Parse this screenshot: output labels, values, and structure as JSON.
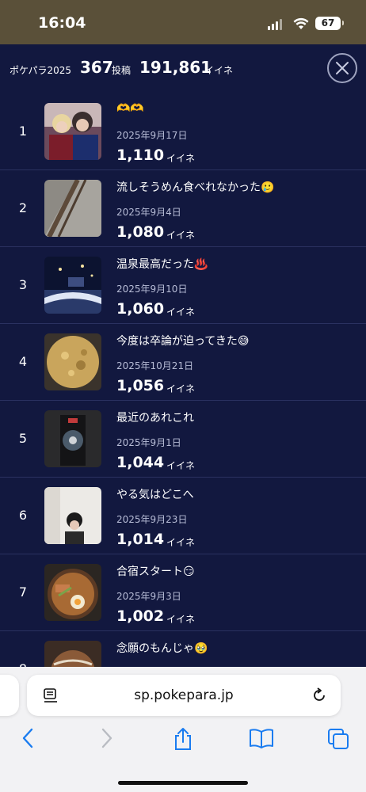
{
  "status_bar": {
    "time": "16:04",
    "battery": "67"
  },
  "header": {
    "app_name": "ポケパラ2025",
    "posts_count": "367",
    "posts_unit": "投稿",
    "likes_count": "191,861",
    "likes_unit": "イイネ"
  },
  "posts": [
    {
      "rank": "1",
      "title": "🫶🫶",
      "date": "2025年9月17日",
      "count": "1,110",
      "unit": "イイネ"
    },
    {
      "rank": "2",
      "title": "流しそうめん食べれなかった🥲",
      "date": "2025年9月4日",
      "count": "1,080",
      "unit": "イイネ"
    },
    {
      "rank": "3",
      "title": "温泉最高だった♨️",
      "date": "2025年9月10日",
      "count": "1,060",
      "unit": "イイネ"
    },
    {
      "rank": "4",
      "title": "今度は卒論が迫ってきた😅",
      "date": "2025年10月21日",
      "count": "1,056",
      "unit": "イイネ"
    },
    {
      "rank": "5",
      "title": "最近のあれこれ",
      "date": "2025年9月1日",
      "count": "1,044",
      "unit": "イイネ"
    },
    {
      "rank": "6",
      "title": "やる気はどこへ",
      "date": "2025年9月23日",
      "count": "1,014",
      "unit": "イイネ"
    },
    {
      "rank": "7",
      "title": "合宿スタート😏",
      "date": "2025年9月3日",
      "count": "1,002",
      "unit": "イイネ"
    },
    {
      "rank": "8",
      "title": "念願のもんじゃ🥹",
      "date": "",
      "count": "",
      "unit": ""
    }
  ],
  "browser": {
    "url": "sp.pokepara.jp"
  },
  "colors": {
    "background": "#12183f",
    "status_bar": "#5a5039",
    "accent": "#1a7cf0"
  }
}
